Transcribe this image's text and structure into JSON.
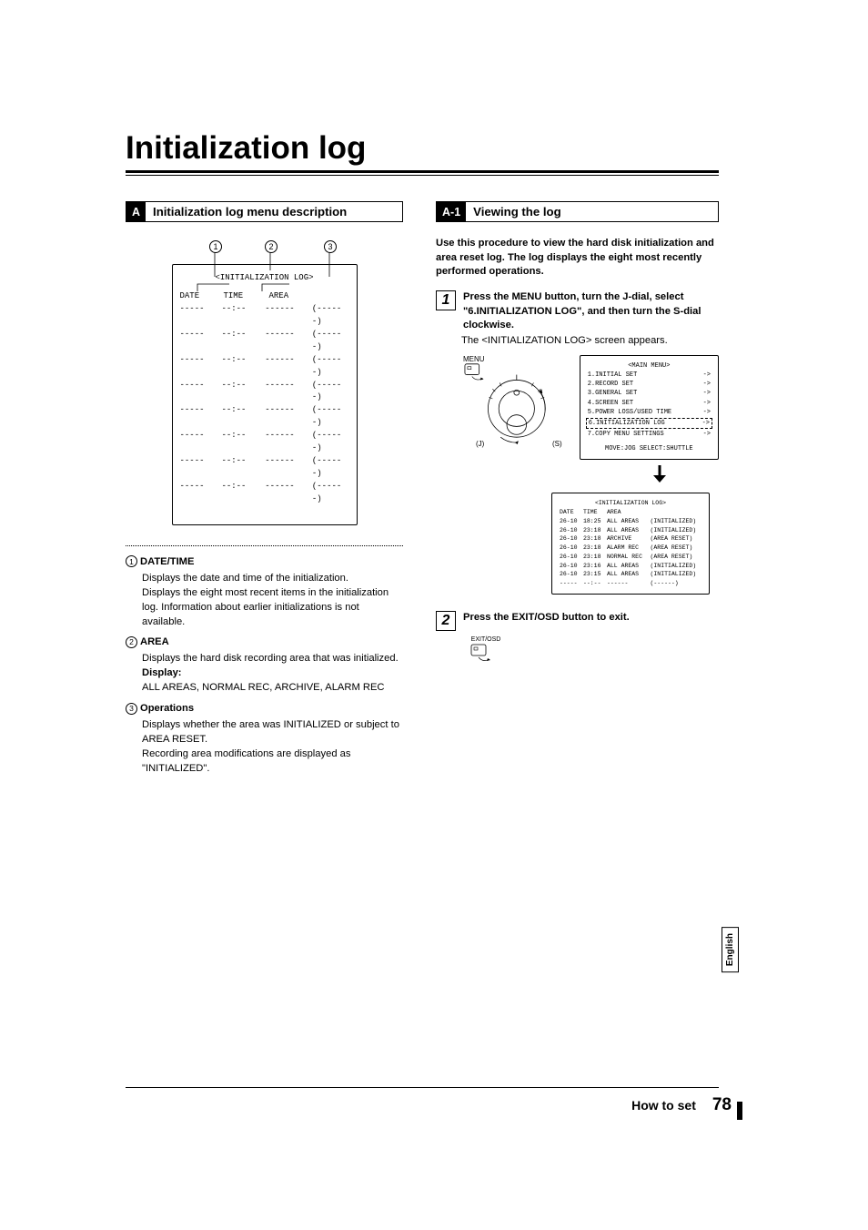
{
  "title": "Initialization log",
  "sections": {
    "A": {
      "tag": "A",
      "title": "Initialization log menu description"
    },
    "A1": {
      "tag": "A-1",
      "title": "Viewing the log"
    }
  },
  "screen_a": {
    "title": "<INITIALIZATION LOG>",
    "headers": {
      "date": "DATE",
      "time": "TIME",
      "area": "AREA"
    },
    "blank": {
      "date": "-----",
      "time": "--:--",
      "area": "------",
      "op": "(------)"
    },
    "blank_rows": [
      "",
      "",
      "",
      "",
      "",
      "",
      "",
      ""
    ]
  },
  "callouts_a": {
    "one": "1",
    "two": "2",
    "three": "3"
  },
  "descriptions": [
    {
      "num": "1",
      "term": "DATE/TIME",
      "lines": [
        "Displays the date and time of the initialization.",
        "Displays the eight most recent items in the initialization log. Information about earlier initializations is not available."
      ]
    },
    {
      "num": "2",
      "term": "AREA",
      "lines": [
        "Displays the hard disk recording area that was initialized."
      ],
      "display_label": "Display:",
      "display_vals": "ALL AREAS, NORMAL REC, ARCHIVE, ALARM REC"
    },
    {
      "num": "3",
      "term": "Operations",
      "lines": [
        "Displays whether the area was INITIALIZED or subject to AREA RESET.",
        "Recording area modifications are displayed as \"INITIALIZED\"."
      ]
    }
  ],
  "right": {
    "intro": "Use this procedure to view the hard disk initialization and area reset log. The log displays the eight most recently performed operations.",
    "steps": [
      {
        "n": "1",
        "bold": "Press the MENU button, turn the J-dial, select \"6.INITIALIZATION LOG\", and then turn the S-dial clockwise.",
        "note": "The <INITIALIZATION LOG> screen appears."
      },
      {
        "n": "2",
        "bold": "Press the EXIT/OSD button to exit."
      }
    ],
    "diag": {
      "menu_lbl": "MENU",
      "j": "(J)",
      "s": "(S)",
      "exit_lbl": "EXIT/OSD"
    },
    "main_menu": {
      "title": "<MAIN MENU>",
      "items": [
        "1.INITIAL SET",
        "2.RECORD SET",
        "3.GENERAL SET",
        "4.SCREEN SET",
        "5.POWER LOSS/USED TIME",
        "6.INITIALIZATION LOG",
        "7.COPY MENU SETTINGS"
      ],
      "arrow": "->",
      "footer": "MOVE:JOG   SELECT:SHUTTLE"
    },
    "log_screen": {
      "title": "<INITIALIZATION LOG>",
      "hdr": {
        "date": "DATE",
        "time": "TIME",
        "area": "AREA"
      },
      "rows": [
        {
          "d": "26-10",
          "t": "18:25",
          "a": "ALL AREAS",
          "o": "(INITIALIZED)"
        },
        {
          "d": "26-10",
          "t": "23:18",
          "a": "ALL AREAS",
          "o": "(INITIALIZED)"
        },
        {
          "d": "26-10",
          "t": "23:18",
          "a": "ARCHIVE",
          "o": "(AREA RESET)"
        },
        {
          "d": "26-10",
          "t": "23:18",
          "a": "ALARM REC",
          "o": "(AREA RESET)"
        },
        {
          "d": "26-10",
          "t": "23:18",
          "a": "NORMAL REC",
          "o": "(AREA RESET)"
        },
        {
          "d": "26-10",
          "t": "23:16",
          "a": "ALL AREAS",
          "o": "(INITIALIZED)"
        },
        {
          "d": "26-10",
          "t": "23:15",
          "a": "ALL AREAS",
          "o": "(INITIALIZED)"
        },
        {
          "d": "-----",
          "t": "--:--",
          "a": "------",
          "o": "(------)"
        }
      ]
    }
  },
  "footer": {
    "section": "How to set",
    "page": "78",
    "lang": "English"
  }
}
